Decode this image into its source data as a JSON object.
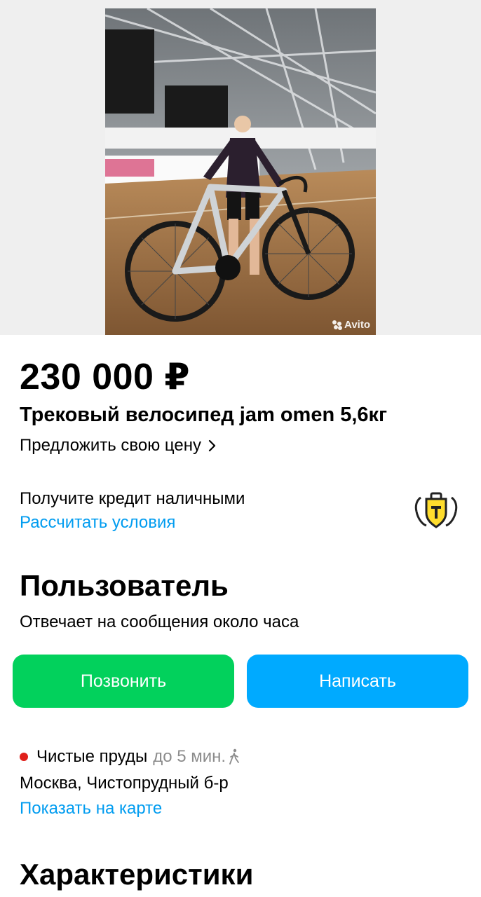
{
  "listing": {
    "price": "230 000 ₽",
    "title": "Трековый велосипед jam omen 5,6кг",
    "offer_price_label": "Предложить свою цену",
    "photo_watermark": "Avito"
  },
  "credit": {
    "text": "Получите кредит наличными",
    "link": "Рассчитать условия",
    "bank_logo_icon": "tinkoff-shield-icon"
  },
  "seller": {
    "heading": "Пользователь",
    "response_time": "Отвечает на сообщения около часа"
  },
  "actions": {
    "call_label": "Позвонить",
    "message_label": "Написать"
  },
  "location": {
    "metro_station": "Чистые пруды",
    "metro_time": "до 5 мин.",
    "address": "Москва, Чистопрудный б-р",
    "map_link": "Показать на карте"
  },
  "specs_heading": "Характеристики",
  "colors": {
    "accent_link": "#009cf0",
    "call_button": "#02d15c",
    "message_button": "#00aaff",
    "metro_line": "#e0201b"
  }
}
